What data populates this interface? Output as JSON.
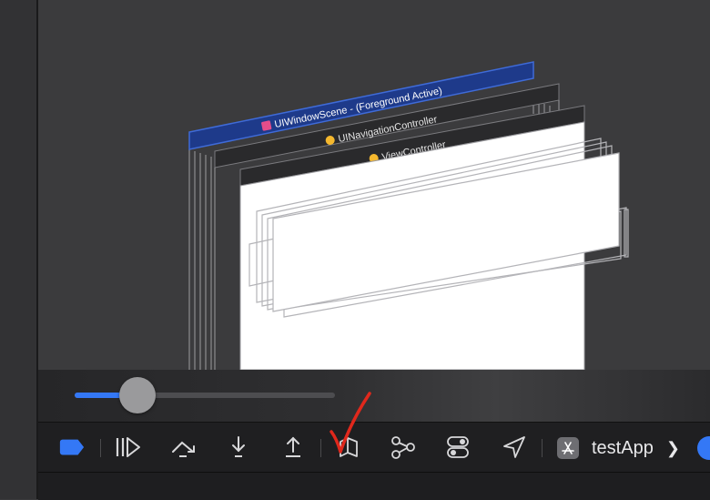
{
  "hierarchy": {
    "window_scene_label": "UIWindowScene - (Foreground Active)",
    "navigation_controller_label": "UINavigationController",
    "view_controller_label": "ViewController"
  },
  "slider": {
    "value": 0.24
  },
  "toolbar": {
    "scheme_name": "testApp",
    "scheme_chevron": "❯",
    "buttons": [
      "breakpoints-toggle-icon",
      "continue-icon",
      "step-over-icon",
      "step-into-icon",
      "step-out-icon",
      "view-hierarchy-icon",
      "memory-graph-icon",
      "environment-overrides-icon",
      "simulate-location-icon"
    ]
  },
  "colors": {
    "accent": "#3478f6",
    "annotation": "#e0281c",
    "scene_frame": "#1e3a8a",
    "window_icon": "#e44d8a",
    "controller_icon": "#f5b82e"
  }
}
